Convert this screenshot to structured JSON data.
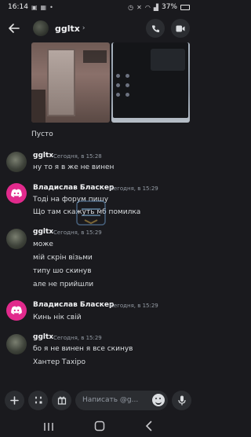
{
  "status_bar": {
    "time": "16:14",
    "battery": "37%"
  },
  "header": {
    "channel_name": "ggltx",
    "chevron": "›"
  },
  "messages": {
    "empty_caption": "Пусто",
    "groups": [
      {
        "author": "ggltx",
        "timestamp": "Сегодня, в 15:28",
        "lines": [
          "ну то я в же не винен"
        ]
      },
      {
        "author": "Владислав Бласкер",
        "timestamp": "Сегодня, в 15:29",
        "lines": [
          "Тоді на форум пишу",
          "Що там скажуть мб помилка"
        ]
      },
      {
        "author": "ggltx",
        "timestamp": "Сегодня, в 15:29",
        "lines": [
          "може",
          "мій скрін візьми",
          "типу шо скинув",
          "але не прийшли"
        ]
      },
      {
        "author": "Владислав Бласкер",
        "timestamp": "Сегодня, в 15:29",
        "lines": [
          "Кинь нік свій"
        ]
      },
      {
        "author": "ggltx",
        "timestamp": "Сегодня, в 15:29",
        "lines": [
          "бо я не винен я все скинув",
          "Хантер Тахіро"
        ]
      }
    ]
  },
  "input": {
    "placeholder": "Написать @g..."
  },
  "colors": {
    "background": "#1a1a1e",
    "discord_avatar": "#e12a8c",
    "button_bg": "#2b2d31"
  },
  "icons": [
    "back-arrow-icon",
    "phone-icon",
    "video-icon",
    "plus-icon",
    "apps-icon",
    "gift-icon",
    "emoji-icon",
    "microphone-icon",
    "recents-icon",
    "home-icon",
    "nav-back-icon"
  ]
}
